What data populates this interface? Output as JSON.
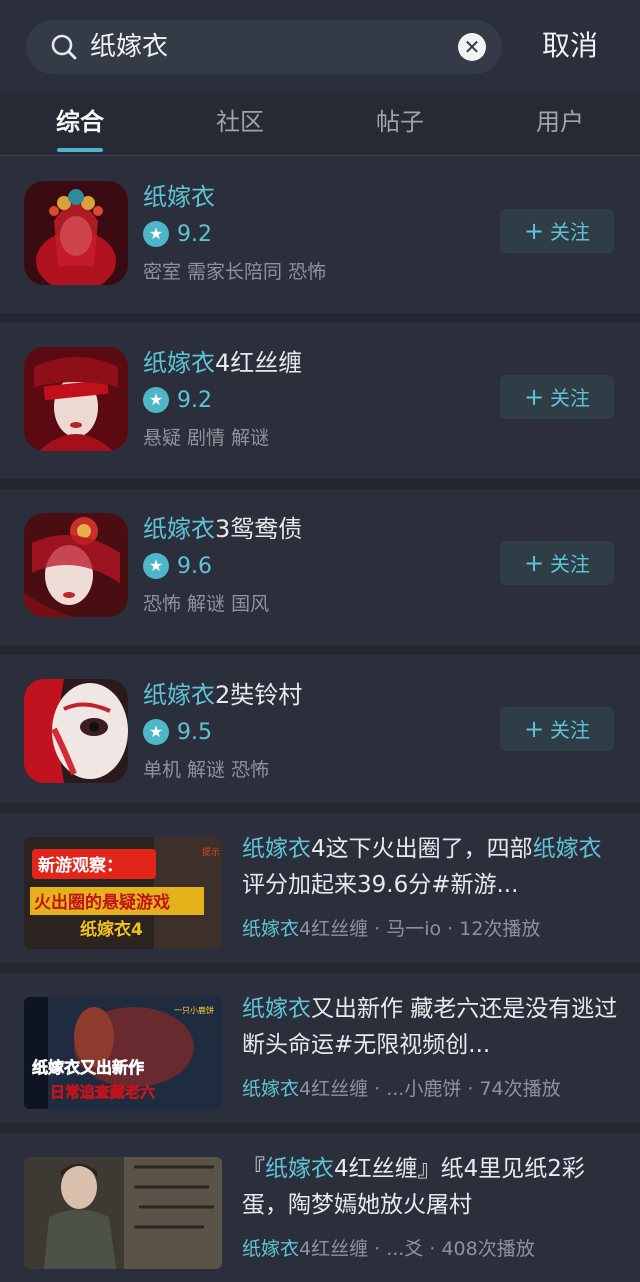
{
  "search": {
    "query": "纸嫁衣",
    "cancel_label": "取消"
  },
  "tabs": [
    {
      "label": "综合"
    },
    {
      "label": "社区"
    },
    {
      "label": "帖子"
    },
    {
      "label": "用户"
    }
  ],
  "games": [
    {
      "title_hl": "纸嫁衣",
      "title_rest": "",
      "rating": "9.2",
      "tags": "密室 需家长陪同 恐怖",
      "follow": "关注"
    },
    {
      "title_hl": "纸嫁衣",
      "title_rest": "4红丝缠",
      "rating": "9.2",
      "tags": "悬疑 剧情 解谜",
      "follow": "关注"
    },
    {
      "title_hl": "纸嫁衣",
      "title_rest": "3鸳鸯债",
      "rating": "9.6",
      "tags": "恐怖 解谜 国风",
      "follow": "关注"
    },
    {
      "title_hl": "纸嫁衣",
      "title_rest": "2奘铃村",
      "rating": "9.5",
      "tags": "单机 解谜 恐怖",
      "follow": "关注"
    }
  ],
  "videos": [
    {
      "title_hl1": "纸嫁衣",
      "title_mid": "4这下火出圈了，四部",
      "title_hl2": "纸嫁衣",
      "title_end": "评分加起来39.6分#新游...",
      "meta_hl": "纸嫁衣",
      "meta_rest": "4红丝缠 · 马一io · 12次播放",
      "thumb_text1": "新游观察：",
      "thumb_text2": "火出圈的悬疑游戏",
      "thumb_text3": "纸嫁衣4",
      "thumb_tag": "提示"
    },
    {
      "title_hl1": "纸嫁衣",
      "title_mid": "又出新作 藏老六还是没有逃过断头命运#无限视频创...",
      "title_hl2": "",
      "title_end": "",
      "meta_hl": "纸嫁衣",
      "meta_rest": "4红丝缠 · ...小鹿饼 · 74次播放",
      "thumb_text1": "纸嫁衣又出新作",
      "thumb_text2": "日常追查藏老六",
      "thumb_text3": "",
      "thumb_tag": "一只小鹿饼"
    },
    {
      "title_pre": "『",
      "title_hl1": "纸嫁衣",
      "title_mid": "4红丝缠』纸4里见纸2彩蛋，陶梦嫣她放火屠村",
      "title_hl2": "",
      "title_end": "",
      "meta_hl": "纸嫁衣",
      "meta_rest": "4红丝缠 · ...爻 · 408次播放",
      "thumb_text1": "",
      "thumb_text2": "",
      "thumb_text3": "",
      "thumb_tag": ""
    }
  ],
  "colors": {
    "accent": "#5fc3d6",
    "background": "#2a2f3b",
    "separator": "#232732"
  }
}
